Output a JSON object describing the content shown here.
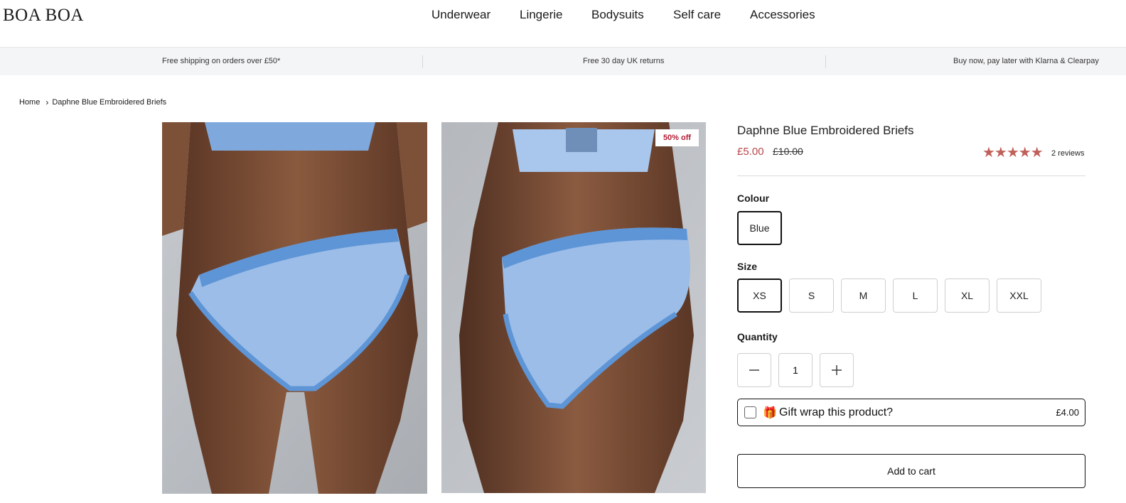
{
  "brand": {
    "logo": "BOA BOA"
  },
  "nav": [
    "Underwear",
    "Lingerie",
    "Bodysuits",
    "Self care",
    "Accessories"
  ],
  "promo": [
    "Free shipping on orders over £50*",
    "Free 30 day UK returns",
    "Buy now, pay later with Klarna & Clearpay"
  ],
  "breadcrumb": {
    "home": "Home",
    "current": "Daphne Blue Embroidered Briefs"
  },
  "gallery": {
    "badge": "50% off"
  },
  "product": {
    "title": "Daphne Blue Embroidered Briefs",
    "price": "£5.00",
    "was_price": "£10.00",
    "rating_stars": "★★★★★",
    "rating": 5,
    "reviews": "2 reviews"
  },
  "colour": {
    "label": "Colour",
    "options": [
      "Blue"
    ],
    "selected": "Blue"
  },
  "size": {
    "label": "Size",
    "options": [
      "XS",
      "S",
      "M",
      "L",
      "XL",
      "XXL"
    ],
    "selected": "XS"
  },
  "quantity": {
    "label": "Quantity",
    "value": "1"
  },
  "gift": {
    "label": "Gift wrap this product?",
    "price": "£4.00",
    "checked": false,
    "icon": "gift-icon"
  },
  "cart": {
    "label": "Add to cart"
  },
  "colors": {
    "sale": "#b8474a",
    "badge": "#b31b34",
    "stars": "#c0605a",
    "promo_bg": "#f4f5f6"
  }
}
